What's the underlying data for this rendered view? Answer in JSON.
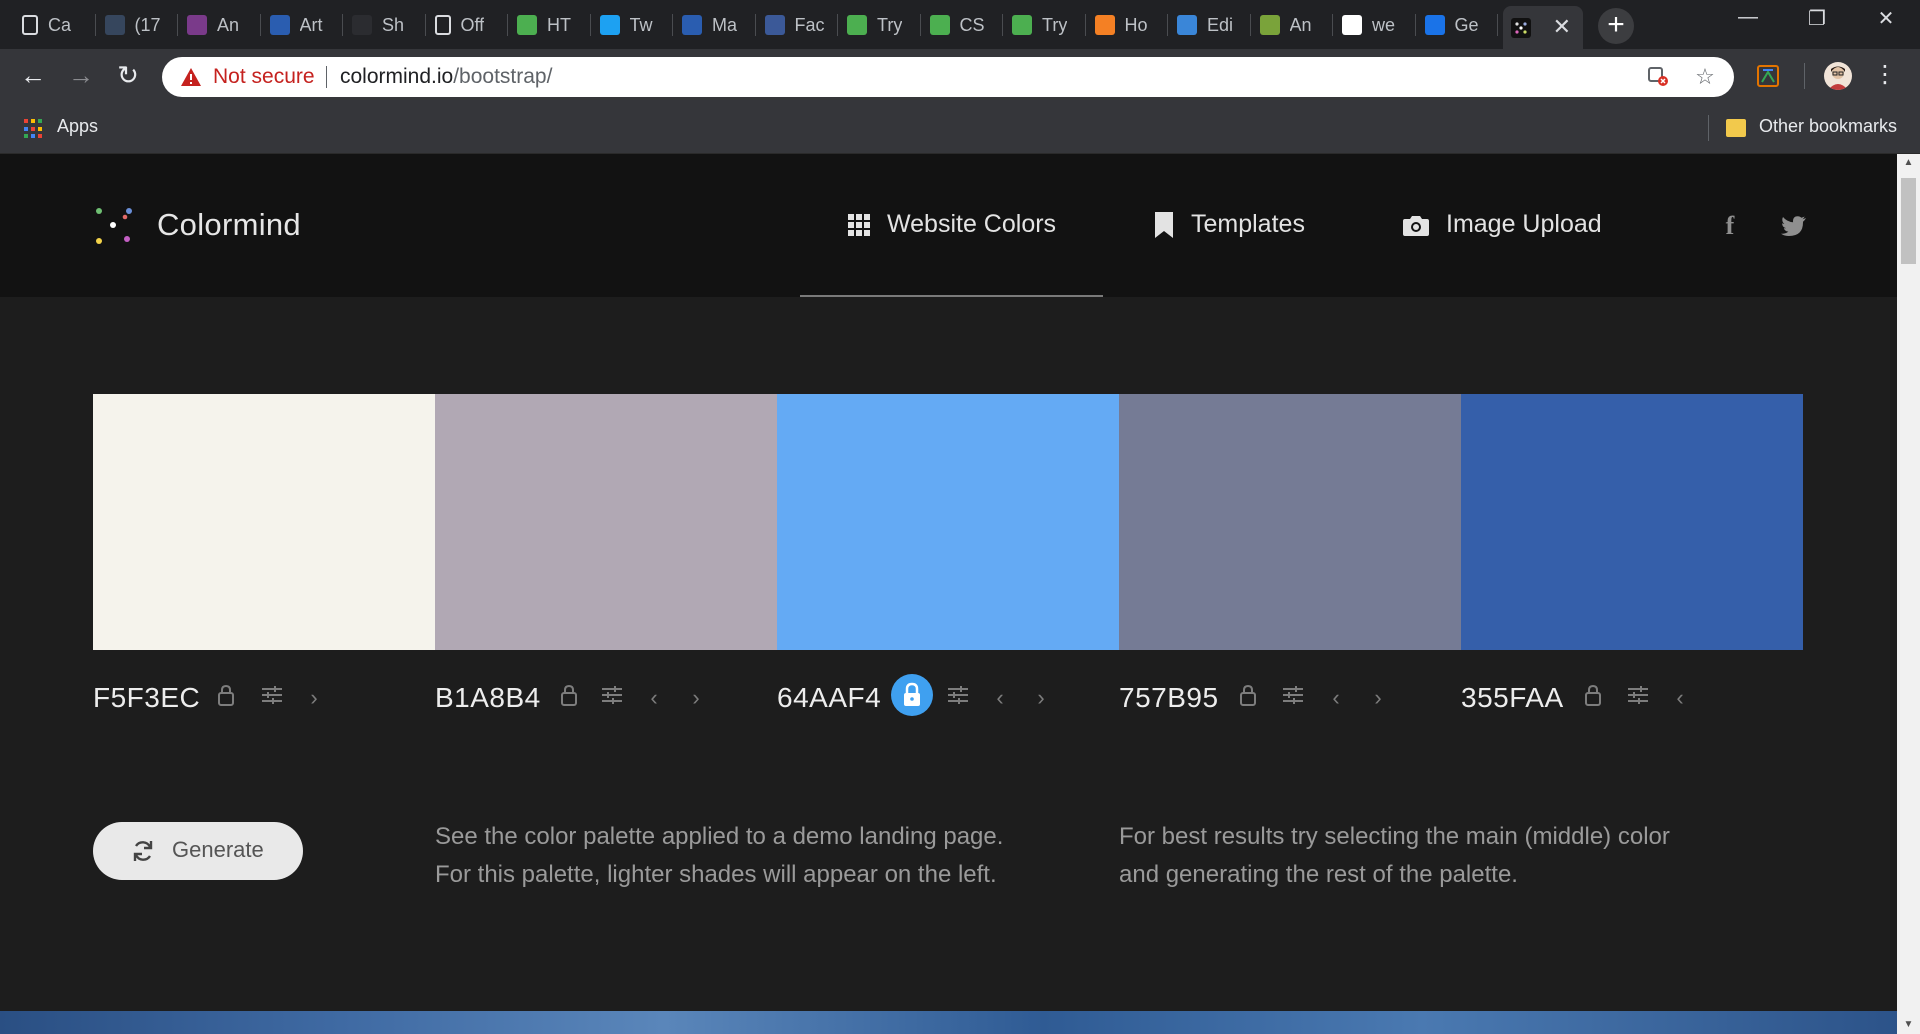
{
  "browser": {
    "tabs": [
      {
        "title": "Ca",
        "icon": "document-icon",
        "color": "#2b2c30"
      },
      {
        "title": "(17",
        "icon": "tumblr-icon",
        "color": "#36465d"
      },
      {
        "title": "An",
        "icon": "image-icon",
        "color": "#7a3a8a"
      },
      {
        "title": "Art",
        "icon": "image-icon",
        "color": "#2a5db0"
      },
      {
        "title": "Sh",
        "icon": "nu-icon",
        "color": "#2b2c30"
      },
      {
        "title": "Off",
        "icon": "document-icon",
        "color": "#2b2c30"
      },
      {
        "title": "HT",
        "icon": "w3-icon",
        "color": "#4caf50"
      },
      {
        "title": "Tw",
        "icon": "twitter-icon",
        "color": "#1da1f2"
      },
      {
        "title": "Ma",
        "icon": "m-icon",
        "color": "#2a5db0"
      },
      {
        "title": "Fac",
        "icon": "facebook-icon",
        "color": "#3b5998"
      },
      {
        "title": "Try",
        "icon": "w3-icon",
        "color": "#4caf50"
      },
      {
        "title": "CS",
        "icon": "w3-icon",
        "color": "#4caf50"
      },
      {
        "title": "Try",
        "icon": "w3-icon",
        "color": "#4caf50"
      },
      {
        "title": "Ho",
        "icon": "stackoverflow-icon",
        "color": "#f48024"
      },
      {
        "title": "Edi",
        "icon": "cloud-icon",
        "color": "#3a86d8"
      },
      {
        "title": "An",
        "icon": "code-icon",
        "color": "#7aa33a"
      },
      {
        "title": "we",
        "icon": "google-icon",
        "color": "#ffffff"
      },
      {
        "title": "Ge",
        "icon": "chrome-icon",
        "color": "#1a73e8"
      }
    ],
    "omnibox": {
      "security": "Not secure",
      "domain": "colormind.io",
      "path": "/bootstrap/"
    },
    "bookmarks": {
      "apps_label": "Apps",
      "other_label": "Other bookmarks"
    }
  },
  "site": {
    "brand": "Colormind",
    "nav": [
      {
        "label": "Website Colors",
        "icon": "grid-icon"
      },
      {
        "label": "Templates",
        "icon": "bookmark-icon"
      },
      {
        "label": "Image Upload",
        "icon": "camera-icon"
      }
    ],
    "social": [
      "facebook-icon",
      "twitter-icon"
    ],
    "palette": [
      {
        "hex": "F5F3EC",
        "color": "#F5F3EC",
        "locked": false,
        "prev": false,
        "next": true
      },
      {
        "hex": "B1A8B4",
        "color": "#B1A8B4",
        "locked": false,
        "prev": true,
        "next": true
      },
      {
        "hex": "64AAF4",
        "color": "#64AAF4",
        "locked": true,
        "prev": true,
        "next": true
      },
      {
        "hex": "757B95",
        "color": "#757B95",
        "locked": false,
        "prev": true,
        "next": true
      },
      {
        "hex": "355FAA",
        "color": "#355FAA",
        "locked": false,
        "prev": true,
        "next": false
      }
    ],
    "generate_label": "Generate",
    "info_left": [
      "See the color palette applied to a demo landing page.",
      "For this palette, lighter shades will appear on the left."
    ],
    "info_right": [
      "For best results try selecting the main (middle) color",
      "and generating the rest of the palette."
    ]
  }
}
